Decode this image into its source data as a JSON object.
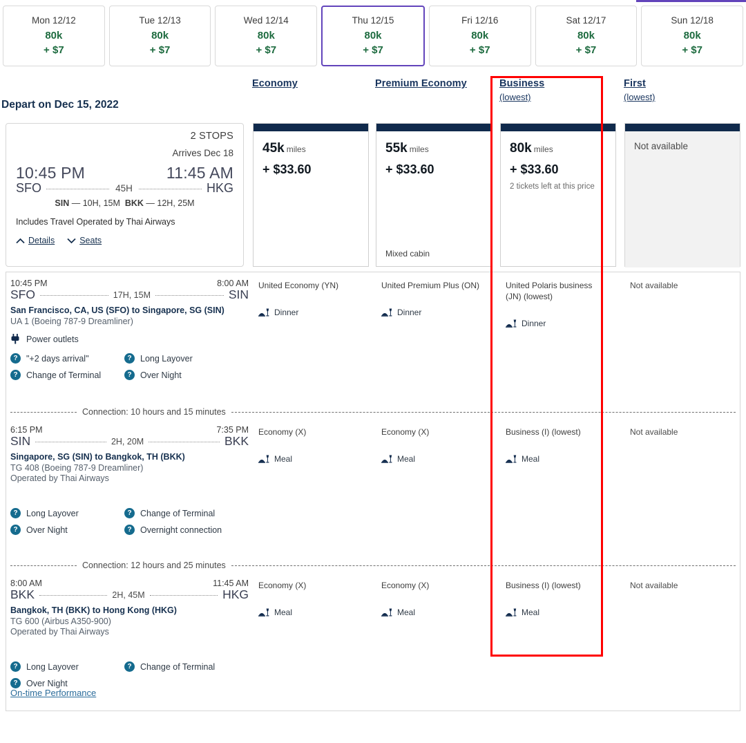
{
  "top_rule_color": "#6244bb",
  "date_strip": {
    "items": [
      {
        "dow": "Mon 12/12",
        "miles": "80k",
        "cash": "+ $7",
        "selected": false
      },
      {
        "dow": "Tue 12/13",
        "miles": "80k",
        "cash": "+ $7",
        "selected": false
      },
      {
        "dow": "Wed 12/14",
        "miles": "80k",
        "cash": "+ $7",
        "selected": false
      },
      {
        "dow": "Thu 12/15",
        "miles": "80k",
        "cash": "+ $7",
        "selected": true
      },
      {
        "dow": "Fri 12/16",
        "miles": "80k",
        "cash": "+ $7",
        "selected": false
      },
      {
        "dow": "Sat 12/17",
        "miles": "80k",
        "cash": "+ $7",
        "selected": false
      },
      {
        "dow": "Sun 12/18",
        "miles": "80k",
        "cash": "+ $7",
        "selected": false
      }
    ]
  },
  "cabins": [
    {
      "title": "Economy",
      "sub": ""
    },
    {
      "title": "Premium Economy",
      "sub": ""
    },
    {
      "title": "Business",
      "sub": "(lowest)"
    },
    {
      "title": "First",
      "sub": "(lowest)"
    }
  ],
  "depart": {
    "title": "Depart on Dec 15, 2022"
  },
  "summary": {
    "stops": "2 STOPS",
    "arrives": "Arrives Dec 18",
    "depart_time": "10:45 PM",
    "arrive_time": "11:45 AM",
    "origin": "SFO",
    "destination": "HKG",
    "duration": "45H",
    "stops_detail_1_code": "SIN",
    "stops_detail_1_time": "— 10H, 15M",
    "stops_detail_2_code": "BKK",
    "stops_detail_2_time": "— 12H, 25M",
    "includes": "Includes Travel Operated by Thai Airways",
    "details_label": "Details",
    "seats_label": "Seats"
  },
  "fares": [
    {
      "miles": "45k",
      "miles_unit": "miles",
      "cash": "+ $33.60",
      "tickets_left": "",
      "mixed": "",
      "available": true
    },
    {
      "miles": "55k",
      "miles_unit": "miles",
      "cash": "+ $33.60",
      "tickets_left": "",
      "mixed": "Mixed cabin",
      "available": true
    },
    {
      "miles": "80k",
      "miles_unit": "miles",
      "cash": "+ $33.60",
      "tickets_left": "2 tickets left at this price",
      "mixed": "",
      "available": true
    },
    {
      "miles": "",
      "miles_unit": "",
      "cash": "",
      "tickets_left": "",
      "mixed": "",
      "available": false,
      "unavailable_label": "Not available"
    }
  ],
  "segments": [
    {
      "dep_time": "10:45 PM",
      "arr_time": "8:00 AM",
      "origin": "SFO",
      "destination": "SIN",
      "duration": "17H, 15M",
      "city_pair": "San Francisco, CA, US (SFO) to Singapore, SG (SIN)",
      "flight": "UA 1 (Boeing 787-9 Dreamliner)",
      "operated_by": "",
      "amenity": "Power outlets",
      "badges": [
        [
          "\"+2 days arrival\"",
          "Long Layover"
        ],
        [
          "Change of Terminal",
          "Over Night"
        ]
      ],
      "cells": [
        {
          "cabin": "United Economy (YN)",
          "meal": "Dinner",
          "available": true
        },
        {
          "cabin": "United Premium Plus (ON)",
          "meal": "Dinner",
          "available": true
        },
        {
          "cabin": "United Polaris business (JN) (lowest)",
          "meal": "Dinner",
          "available": true
        },
        {
          "cabin": "Not available",
          "meal": "",
          "available": false
        }
      ],
      "connection": "Connection: 10 hours and 15 minutes"
    },
    {
      "dep_time": "6:15 PM",
      "arr_time": "7:35 PM",
      "origin": "SIN",
      "destination": "BKK",
      "duration": "2H, 20M",
      "city_pair": "Singapore, SG (SIN) to Bangkok, TH (BKK)",
      "flight": "TG 408 (Boeing 787-9 Dreamliner)",
      "operated_by": "Operated by Thai Airways",
      "amenity": "",
      "badges": [
        [
          "Long Layover",
          "Change of Terminal"
        ],
        [
          "Over Night",
          "Overnight connection"
        ]
      ],
      "cells": [
        {
          "cabin": "Economy (X)",
          "meal": "Meal",
          "available": true
        },
        {
          "cabin": "Economy (X)",
          "meal": "Meal",
          "available": true
        },
        {
          "cabin": "Business (I) (lowest)",
          "meal": "Meal",
          "available": true
        },
        {
          "cabin": "Not available",
          "meal": "",
          "available": false
        }
      ],
      "connection": "Connection: 12 hours and 25 minutes"
    },
    {
      "dep_time": "8:00 AM",
      "arr_time": "11:45 AM",
      "origin": "BKK",
      "destination": "HKG",
      "duration": "2H, 45M",
      "city_pair": "Bangkok, TH (BKK) to Hong Kong (HKG)",
      "flight": "TG 600 (Airbus A350-900)",
      "operated_by": "Operated by Thai Airways",
      "amenity": "",
      "badges": [
        [
          "Long Layover",
          "Change of Terminal"
        ],
        [
          "Over Night",
          ""
        ]
      ],
      "cells": [
        {
          "cabin": "Economy (X)",
          "meal": "Meal",
          "available": true
        },
        {
          "cabin": "Economy (X)",
          "meal": "Meal",
          "available": true
        },
        {
          "cabin": "Business (I) (lowest)",
          "meal": "Meal",
          "available": true
        },
        {
          "cabin": "Not available",
          "meal": "",
          "available": false
        }
      ],
      "connection": ""
    }
  ],
  "footer": {
    "otp_label": "On-time Performance"
  },
  "annotation": {
    "color": "#ff0000",
    "target": "business-column"
  },
  "colors": {
    "accent_purple": "#6244bb",
    "navy": "#102a4c",
    "green": "#1d6b3f",
    "link": "#19355e",
    "red": "#ff0000"
  }
}
